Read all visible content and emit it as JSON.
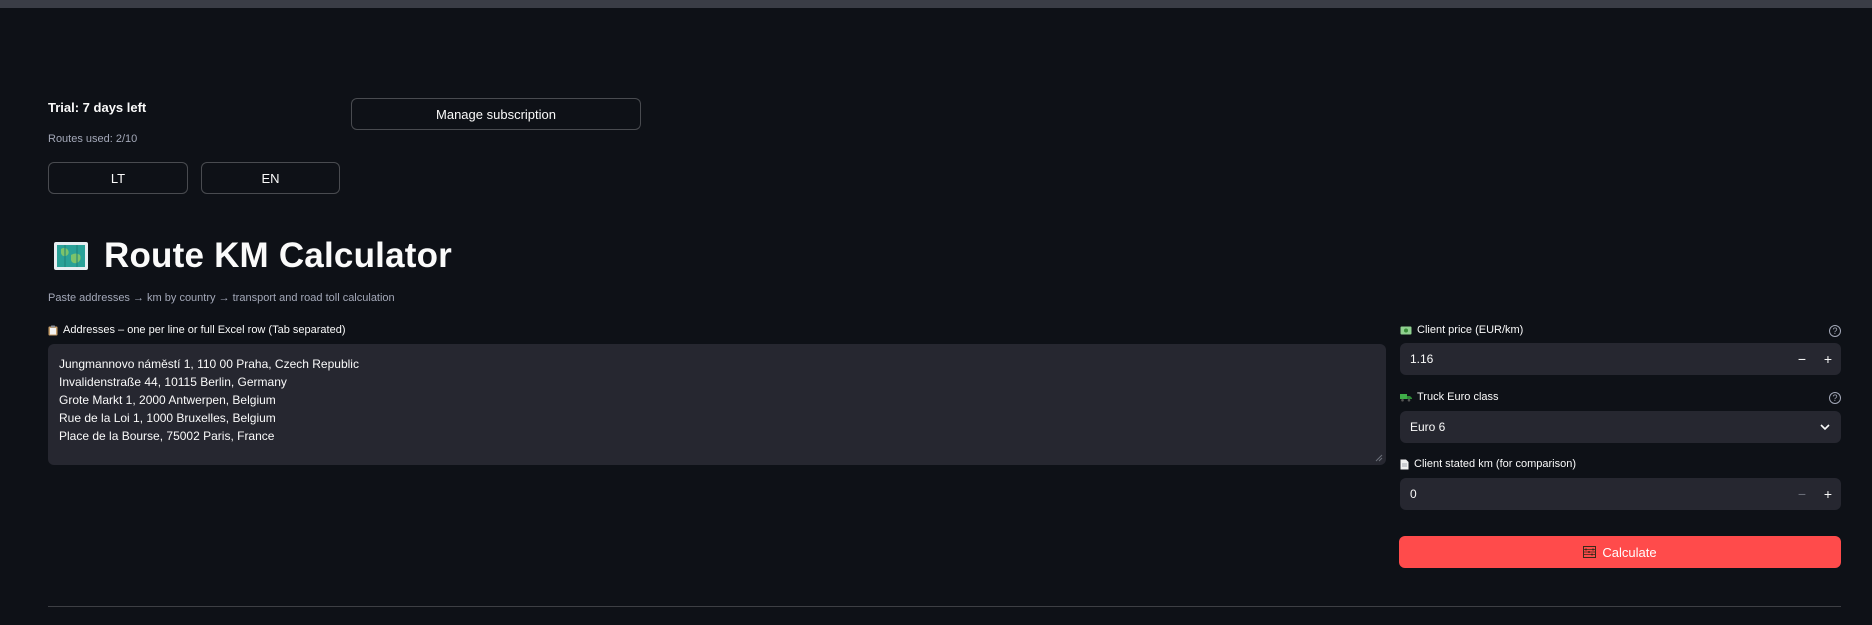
{
  "sidebar_status": {
    "trial": "Trial: 7 days left",
    "routes_used": "Routes used: 2/10"
  },
  "buttons": {
    "manage_subscription": "Manage subscription",
    "lang_lt": "LT",
    "lang_en": "EN",
    "calculate": "Calculate"
  },
  "header": {
    "title": "Route KM Calculator",
    "subtitle": "Paste addresses → km by country → transport and road toll calculation",
    "title_icon": "world-map-icon"
  },
  "addresses": {
    "label": "Addresses – one per line or full Excel row (Tab separated)",
    "lines": [
      "Jungmannovo náměstí 1, 110 00 Praha, Czech Republic",
      "Invalidenstraße 44, 10115 Berlin, Germany",
      "Grote Markt 1, 2000 Antwerpen, Belgium",
      "Rue de la Loi 1, 1000 Bruxelles, Belgium",
      "Place de la Bourse, 75002 Paris, France"
    ]
  },
  "client_price": {
    "label": "Client price (EUR/km)",
    "value": "1.16",
    "minus": "−",
    "plus": "+"
  },
  "truck_class": {
    "label": "Truck Euro class",
    "value": "Euro 6"
  },
  "client_km": {
    "label": "Client stated km (for comparison)",
    "value": "0",
    "minus": "−",
    "plus": "+"
  },
  "colors": {
    "background": "#0e1117",
    "input_bg": "#262730",
    "accent": "#ff4b4b",
    "muted_text": "#a3a8b8"
  }
}
